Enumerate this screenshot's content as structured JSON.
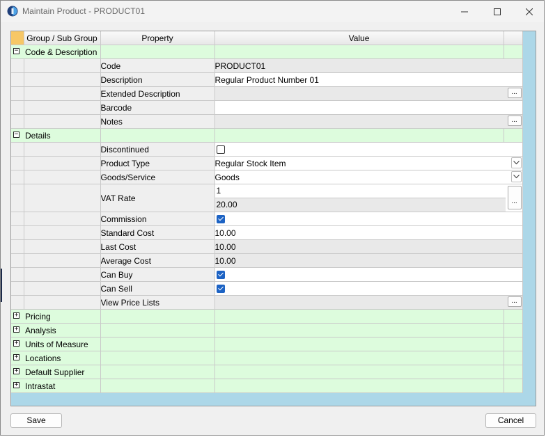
{
  "window": {
    "title": "Maintain Product - PRODUCT01",
    "minimize_icon": "minimize-icon",
    "maximize_icon": "maximize-icon",
    "close_icon": "close-icon"
  },
  "grid": {
    "columns": [
      "Group / Sub Group",
      "Property",
      "Value"
    ],
    "groups": {
      "code": {
        "label": "Code & Description",
        "toggle": "−",
        "rows": {
          "code": {
            "property": "Code",
            "value": "PRODUCT01"
          },
          "description": {
            "property": "Description",
            "value": "Regular Product Number 01"
          },
          "extended": {
            "property": "Extended Description",
            "value": ""
          },
          "barcode": {
            "property": "Barcode",
            "value": ""
          },
          "notes": {
            "property": "Notes",
            "value": ""
          }
        }
      },
      "details": {
        "label": "Details",
        "toggle": "−",
        "rows": {
          "discontinued": {
            "property": "Discontinued",
            "checked": false
          },
          "product_type": {
            "property": "Product Type",
            "value": "Regular Stock Item"
          },
          "goods_service": {
            "property": "Goods/Service",
            "value": "Goods"
          },
          "vat_rate": {
            "property": "VAT Rate",
            "code": "1",
            "rate": "20.00"
          },
          "commission": {
            "property": "Commission",
            "checked": true
          },
          "standard_cost": {
            "property": "Standard Cost",
            "value": "10.00"
          },
          "last_cost": {
            "property": "Last Cost",
            "value": "10.00"
          },
          "average_cost": {
            "property": "Average Cost",
            "value": "10.00"
          },
          "can_buy": {
            "property": "Can Buy",
            "checked": true
          },
          "can_sell": {
            "property": "Can Sell",
            "checked": true
          },
          "view_price_lists": {
            "property": "View Price Lists",
            "value": ""
          }
        }
      },
      "pricing": {
        "label": "Pricing",
        "toggle": "+"
      },
      "analysis": {
        "label": "Analysis",
        "toggle": "+"
      },
      "units": {
        "label": "Units of Measure",
        "toggle": "+"
      },
      "locations": {
        "label": "Locations",
        "toggle": "+"
      },
      "supplier": {
        "label": "Default Supplier",
        "toggle": "+"
      },
      "intrastat": {
        "label": "Intrastat",
        "toggle": "+"
      }
    },
    "ellipsis_label": "...",
    "colors": {
      "group_bg": "#ddfcdd",
      "grid_bg": "#acd7e8",
      "checkbox": "#1d63c4",
      "corner": "#f7c766"
    }
  },
  "footer": {
    "save_label": "Save",
    "cancel_label": "Cancel"
  }
}
